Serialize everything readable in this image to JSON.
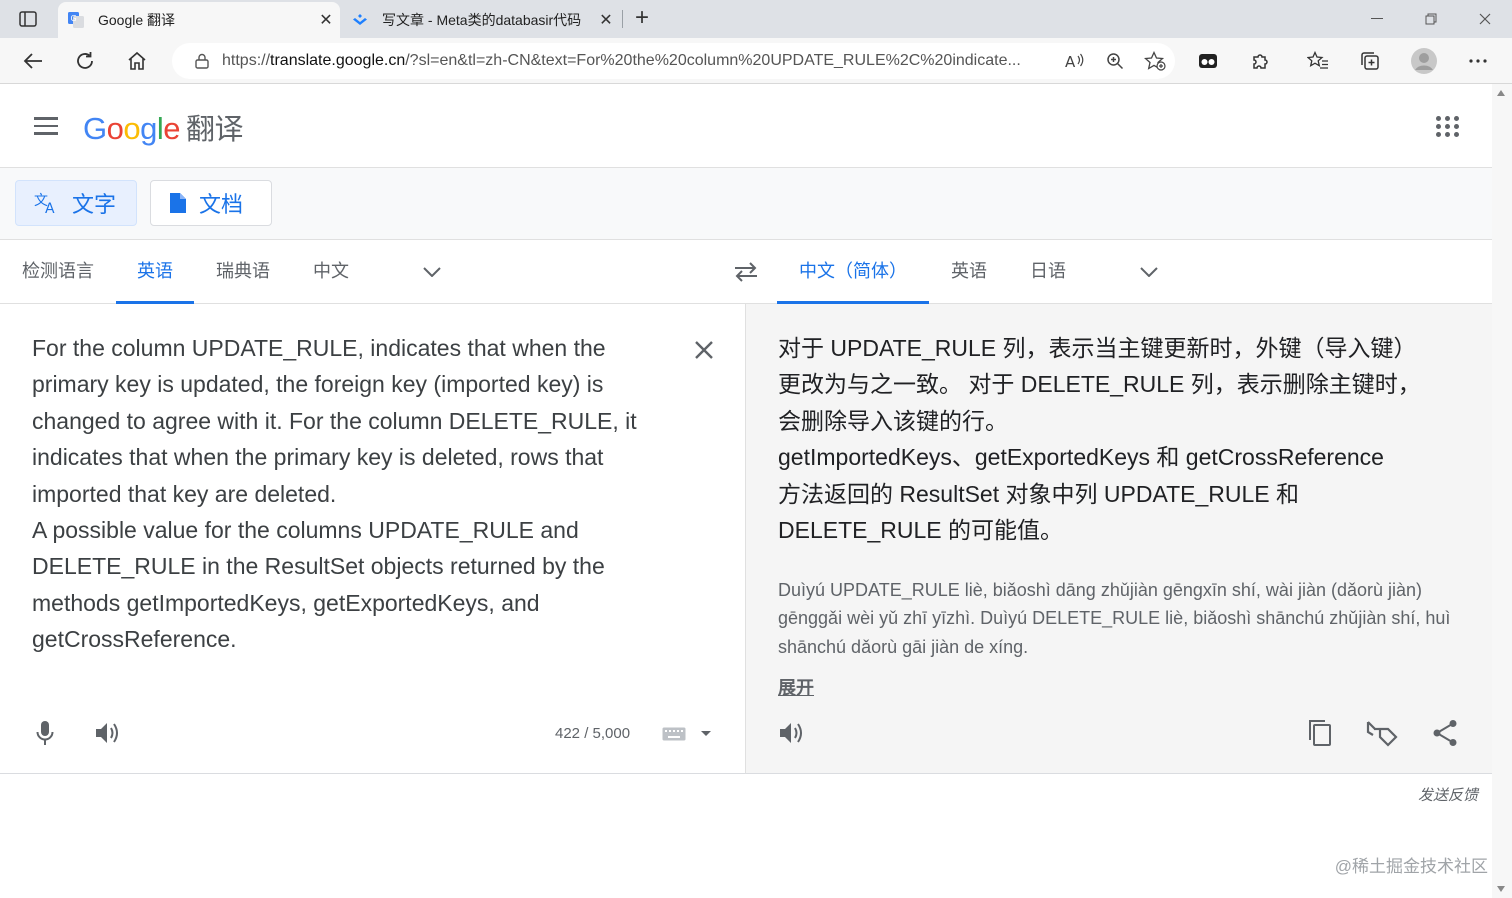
{
  "browser": {
    "tabs": [
      {
        "title": "Google 翻译",
        "active": true
      },
      {
        "title": "写文章 - Meta类的databasir代码",
        "active": false
      }
    ],
    "url_prefix": "https://",
    "url_host": "translate.google.cn",
    "url_rest": "/?sl=en&tl=zh-CN&text=For%20the%20column%20UPDATE_RULE%2C%20indicate..."
  },
  "header": {
    "logo_text": [
      "G",
      "o",
      "o",
      "g",
      "l",
      "e"
    ],
    "logo_zh": "翻译"
  },
  "modes": {
    "text_label": "文字",
    "docs_label": "文档"
  },
  "source_langs": {
    "detect": "检测语言",
    "english": "英语",
    "swedish": "瑞典语",
    "chinese": "中文"
  },
  "target_langs": {
    "chinese_simplified": "中文（简体）",
    "english": "英语",
    "japanese": "日语"
  },
  "source": {
    "text": "For the column UPDATE_RULE, indicates that when the\nprimary key is updated, the foreign key (imported key) is\nchanged to agree with it. For the column DELETE_RULE, it\nindicates that when the primary key is deleted, rows that\nimported that key are deleted.\nA possible value for the columns UPDATE_RULE and\nDELETE_RULE in the ResultSet objects returned by the\nmethods getImportedKeys, getExportedKeys, and\ngetCrossReference.",
    "char_count": "422 / 5,000"
  },
  "target": {
    "lines": [
      "对于 UPDATE_RULE 列，表示当主键更新时，外键（导入键）",
      "更改为与之一致。 对于 DELETE_RULE 列，表示删除主键时，",
      "会删除导入该键的行。",
      "getImportedKeys、getExportedKeys 和 getCrossReference",
      "方法返回的 ResultSet 对象中列 UPDATE_RULE 和",
      "DELETE_RULE 的可能值。"
    ],
    "pinyin": "Duìyú UPDATE_RULE liè, biǎoshì dāng zhǔjiàn gēngxīn shí, wài jiàn (dǎorù jiàn) gēnggǎi wèi yǔ zhī yīzhì. Duìyú DELETE_RULE liè, biǎoshì shānchú zhǔjiàn shí, huì shānchú dǎorù gāi jiàn de xíng.",
    "expand_label": "展开"
  },
  "footer": {
    "feedback": "发送反馈",
    "watermark": "@稀土掘金技术社区"
  },
  "colors": {
    "accent": "#1a73e8",
    "target_bg": "#f5f5f5"
  }
}
